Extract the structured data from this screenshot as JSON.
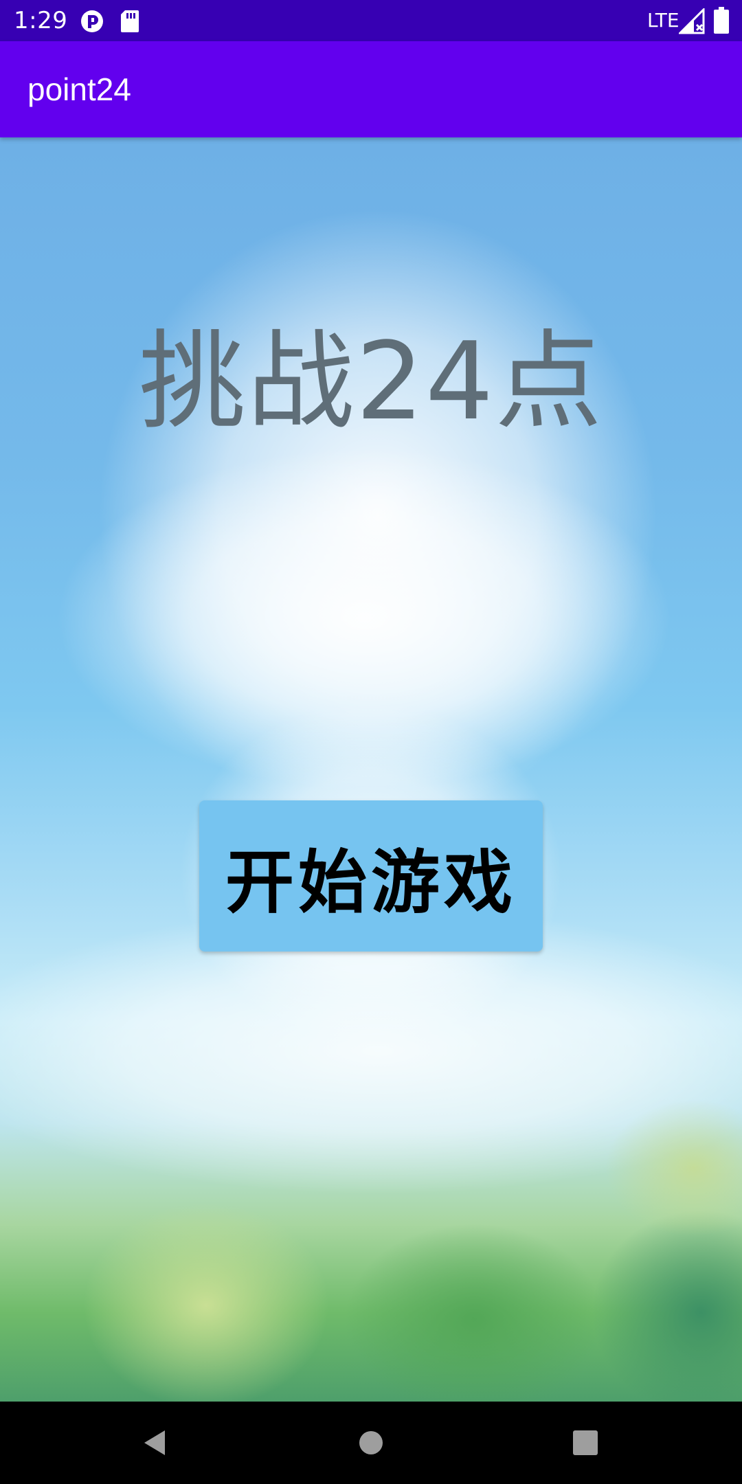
{
  "status_bar": {
    "time": "1:29",
    "network": "LTE",
    "icons": [
      "record-icon",
      "sd-card-icon",
      "signal-no-data-icon",
      "battery-icon"
    ]
  },
  "app_bar": {
    "title": "point24"
  },
  "main": {
    "headline": "挑战24点",
    "start_button_label": "开始游戏"
  },
  "nav_bar": {
    "icons": [
      "back-icon",
      "home-icon",
      "recents-icon"
    ]
  },
  "colors": {
    "status_bar": "#3700b3",
    "app_bar": "#6200ee",
    "button": "#76c4f0",
    "headline": "#5f6e78"
  }
}
